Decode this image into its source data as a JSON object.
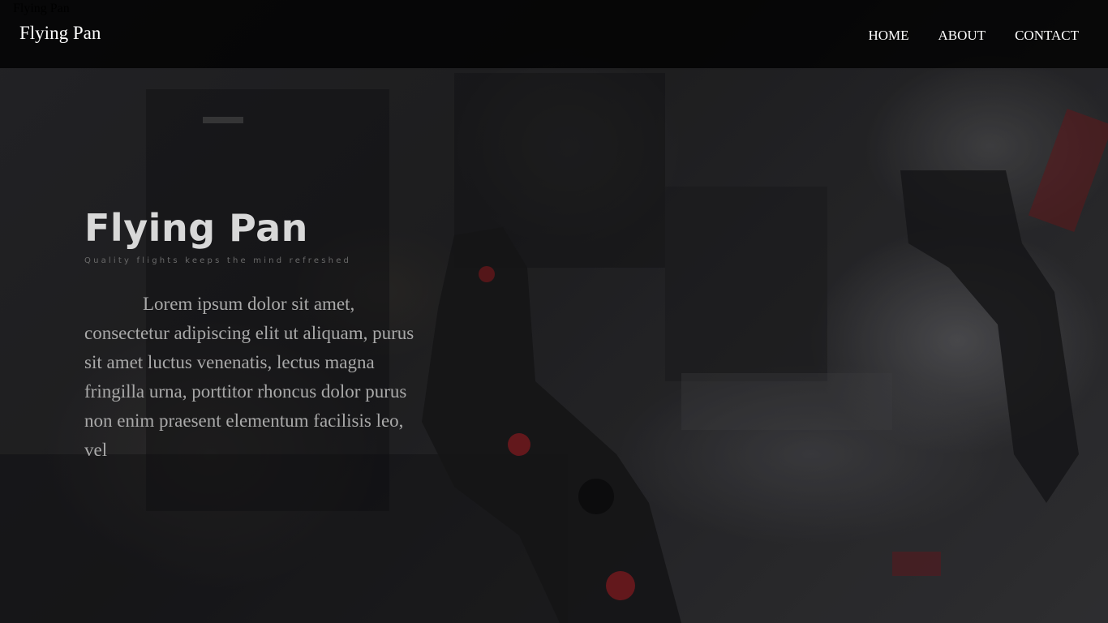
{
  "document": {
    "title": "Flying Pan"
  },
  "navbar": {
    "brand": "Flying Pan",
    "links": [
      {
        "label": "HOME"
      },
      {
        "label": "ABOUT"
      },
      {
        "label": "CONTACT"
      }
    ]
  },
  "hero": {
    "title": "Flying Pan",
    "tagline": "Quality flights keeps the mind refreshed",
    "body": "Lorem ipsum dolor sit amet, consectetur adipiscing elit ut aliquam, purus sit amet luctus venenatis, lectus magna fringilla urna, porttitor rhoncus dolor purus non enim praesent elementum facilisis leo, vel",
    "background_image": "blurred aircraft cockpit with control yoke"
  },
  "colors": {
    "navbar_bg": "#000000",
    "hero_title": "#d8d8d8",
    "hero_body": "#a9a9a9",
    "nav_text": "#ffffff"
  }
}
